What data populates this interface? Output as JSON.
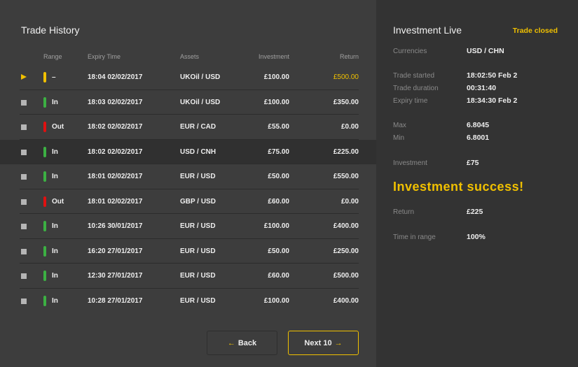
{
  "trade_history": {
    "title": "Trade History",
    "columns": {
      "range": "Range",
      "expiry": "Expiry Time",
      "assets": "Assets",
      "investment": "Investment",
      "return": "Return"
    },
    "rows": [
      {
        "status": "active",
        "range": "–",
        "range_color": "#f0c000",
        "expiry": "18:04 02/02/2017",
        "asset": "UKOil / USD",
        "investment": "£100.00",
        "return": "£500.00",
        "return_color": "#f0c000"
      },
      {
        "status": "closed",
        "range": "In",
        "range_color": "#3cb043",
        "expiry": "18:03 02/02/2017",
        "asset": "UKOil / USD",
        "investment": "£100.00",
        "return": "£350.00"
      },
      {
        "status": "closed",
        "range": "Out",
        "range_color": "#e01010",
        "expiry": "18:02 02/02/2017",
        "asset": "EUR / CAD",
        "investment": "£55.00",
        "return": "£0.00"
      },
      {
        "status": "selected",
        "range": "In",
        "range_color": "#3cb043",
        "expiry": "18:02 02/02/2017",
        "asset": "USD / CNH",
        "investment": "£75.00",
        "return": "£225.00"
      },
      {
        "status": "closed",
        "range": "In",
        "range_color": "#3cb043",
        "expiry": "18:01 02/02/2017",
        "asset": "EUR / USD",
        "investment": "£50.00",
        "return": "£550.00"
      },
      {
        "status": "closed",
        "range": "Out",
        "range_color": "#e01010",
        "expiry": "18:01 02/02/2017",
        "asset": "GBP / USD",
        "investment": "£60.00",
        "return": "£0.00"
      },
      {
        "status": "closed",
        "range": "In",
        "range_color": "#3cb043",
        "expiry": "10:26 30/01/2017",
        "asset": "EUR / USD",
        "investment": "£100.00",
        "return": "£400.00"
      },
      {
        "status": "closed",
        "range": "In",
        "range_color": "#3cb043",
        "expiry": "16:20 27/01/2017",
        "asset": "EUR / USD",
        "investment": "£50.00",
        "return": "£250.00"
      },
      {
        "status": "closed",
        "range": "In",
        "range_color": "#3cb043",
        "expiry": "12:30 27/01/2017",
        "asset": "EUR / USD",
        "investment": "£60.00",
        "return": "£500.00"
      },
      {
        "status": "closed",
        "range": "In",
        "range_color": "#3cb043",
        "expiry": "10:28 27/01/2017",
        "asset": "EUR / USD",
        "investment": "£100.00",
        "return": "£400.00"
      }
    ],
    "back_label": "Back",
    "next_label": "Next 10",
    "back_arrow": "←",
    "next_arrow": "→"
  },
  "investment_live": {
    "title": "Investment Live",
    "status": "Trade closed",
    "success": "Investment success!",
    "fields": [
      {
        "label": "Currencies",
        "value": "USD / CHN"
      },
      {
        "label": "Trade started",
        "value": "18:02:50 Feb 2"
      },
      {
        "label": "Trade duration",
        "value": "00:31:40"
      },
      {
        "label": "Expiry time",
        "value": "18:34:30 Feb 2"
      },
      {
        "label": "Max",
        "value": "6.8045"
      },
      {
        "label": "Min",
        "value": "6.8001"
      },
      {
        "label": "Investment",
        "value": "£75"
      },
      {
        "label": "Return",
        "value": "£225"
      },
      {
        "label": "Time in range",
        "value": "100%"
      }
    ]
  },
  "colors": {
    "accent": "#f0c000",
    "in": "#3cb043",
    "out": "#e01010"
  }
}
